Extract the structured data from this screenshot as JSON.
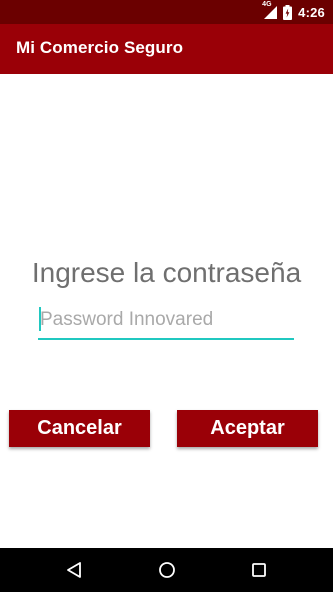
{
  "status_bar": {
    "network_label": "4G",
    "time": "4:26",
    "icons": [
      "signal-icon",
      "battery-icon"
    ]
  },
  "app_bar": {
    "title": "Mi Comercio Seguro"
  },
  "password_screen": {
    "prompt": "Ingrese la contraseña",
    "password_value": "",
    "password_placeholder": "Password Innovared"
  },
  "actions": {
    "cancel_label": "Cancelar",
    "accept_label": "Aceptar"
  },
  "nav_bar": {
    "icons": [
      "back-icon",
      "home-icon",
      "recents-icon"
    ]
  },
  "colors": {
    "status_bar": "#6b0000",
    "app_bar": "#9a0007",
    "button": "#9a0007",
    "accent": "#20c8c0",
    "prompt_text": "#6f6f6f",
    "nav_bar": "#000000"
  }
}
